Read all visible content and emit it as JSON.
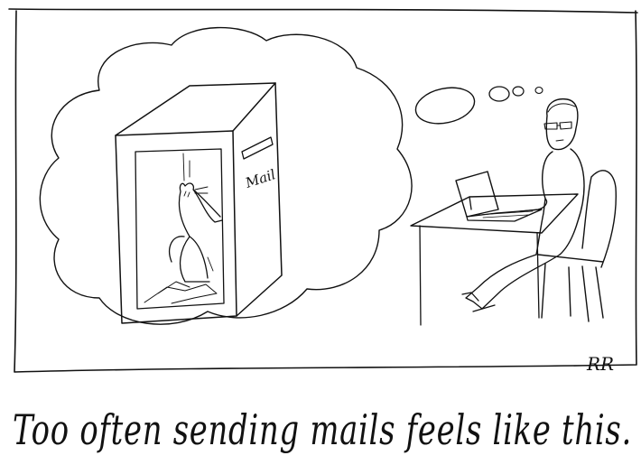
{
  "comic": {
    "caption": "Too often sending mails feels like this.",
    "mailbox_label": "Mail",
    "signature": "RR"
  }
}
